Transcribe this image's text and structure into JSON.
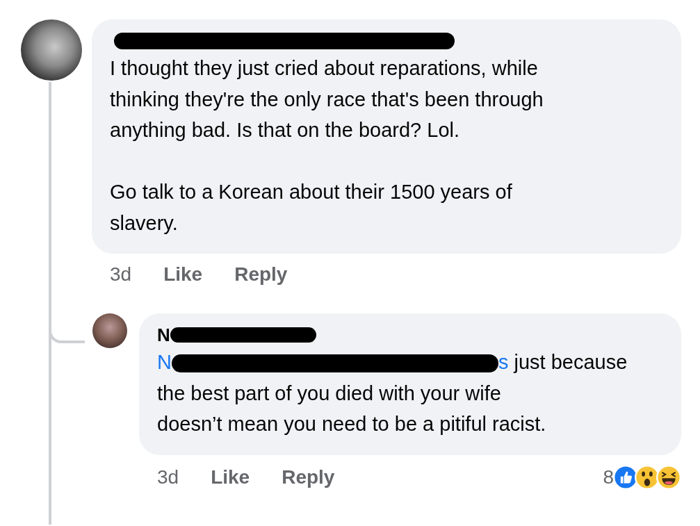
{
  "comments": [
    {
      "name_redacted": true,
      "text": "I thought they just cried about reparations, while\nthinking they're the only race that's been through\nanything bad. Is that on the board? Lol.\n\nGo talk to a Korean about their 1500 years of\nslavery.",
      "time": "3d",
      "like": "Like",
      "reply": "Reply"
    }
  ],
  "replies": [
    {
      "name": "N",
      "name_redacted": true,
      "mention_start": "N",
      "mention_end": "s",
      "text": " just because\nthe best part of you died with your wife\ndoesn’t mean you need to be a pitiful racist.",
      "time": "3d",
      "like": "Like",
      "reply": "Reply",
      "reaction_count": "8",
      "reactions": [
        {
          "kind": "like"
        },
        {
          "kind": "wow"
        },
        {
          "kind": "haha"
        }
      ]
    }
  ]
}
